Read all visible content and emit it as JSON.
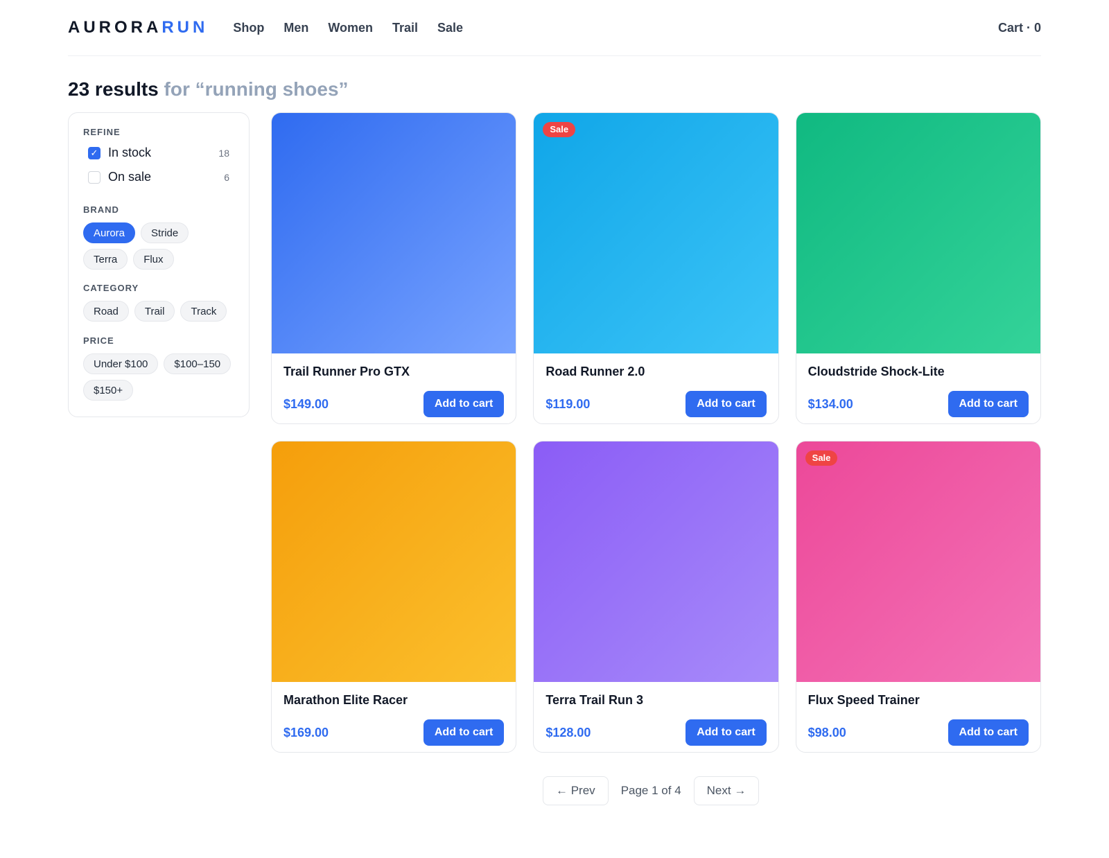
{
  "header": {
    "logo_main": "AURORA",
    "logo_accent": "RUN",
    "nav": [
      "Shop",
      "Men",
      "Women",
      "Trail",
      "Sale"
    ],
    "cart": "Cart · 0"
  },
  "results": {
    "count_text": "23 results",
    "query_text": "for “running shoes”"
  },
  "filters": {
    "refine": {
      "title": "REFINE",
      "options": [
        {
          "label": "In stock",
          "count": "18",
          "checked": true
        },
        {
          "label": "On sale",
          "count": "6",
          "checked": false
        }
      ]
    },
    "brand": {
      "title": "BRAND",
      "chips": [
        "Aurora",
        "Stride",
        "Terra",
        "Flux"
      ],
      "active": "Aurora"
    },
    "category": {
      "title": "CATEGORY",
      "chips": [
        "Road",
        "Trail",
        "Track"
      ]
    },
    "price": {
      "title": "PRICE",
      "chips": [
        "Under $100",
        "$100–150",
        "$150+"
      ]
    }
  },
  "products": [
    {
      "name": "Trail Runner Pro GTX",
      "price": "$149.00",
      "button": "Add to cart",
      "badge": "",
      "color": "#2f6bf0"
    },
    {
      "name": "Road Runner 2.0",
      "price": "$119.00",
      "button": "Add to cart",
      "badge": "Sale",
      "color": "#10a6e8"
    },
    {
      "name": "Cloudstride Shock-Lite",
      "price": "$134.00",
      "button": "Add to cart",
      "badge": "",
      "color": "#10b981"
    },
    {
      "name": "Marathon Elite Racer",
      "price": "$169.00",
      "button": "Add to cart",
      "badge": "",
      "color": "#f59e0b"
    },
    {
      "name": "Terra Trail Run 3",
      "price": "$128.00",
      "button": "Add to cart",
      "badge": "",
      "color": "#8b5cf6"
    },
    {
      "name": "Flux Speed Trainer",
      "price": "$98.00",
      "button": "Add to cart",
      "badge": "Sale",
      "color": "#ec4899"
    }
  ],
  "pagination": {
    "prev": "← Prev",
    "info": "Page 1 of 4",
    "next": "Next →"
  },
  "colors": {
    "accent": "#2f6bf0",
    "sale": "#ef4444"
  }
}
